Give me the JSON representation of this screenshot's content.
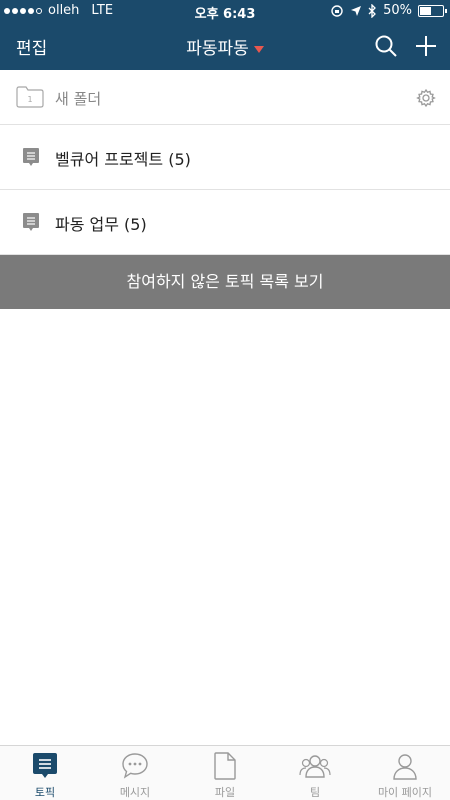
{
  "status_bar": {
    "carrier": "olleh",
    "network": "LTE",
    "time": "오후 6:43",
    "battery": "50%",
    "battery_level": 0.5
  },
  "navbar": {
    "edit_label": "편집",
    "title": "파동파동",
    "search_icon": "search-icon",
    "add_icon": "plus-icon",
    "caret_color": "#e8584f",
    "background_color": "#1b4a6b"
  },
  "folder": {
    "badge": "1",
    "label": "새 폴더",
    "settings_icon": "gear-icon"
  },
  "topics": [
    {
      "label": "벨큐어 프로젝트 (5)"
    },
    {
      "label": "파동 업무 (5)"
    }
  ],
  "show_unjoined_button": "참여하지 않은 토픽 목록 보기",
  "tabbar": {
    "items": [
      {
        "label": "토픽",
        "icon": "topic-icon",
        "active": true
      },
      {
        "label": "메시지",
        "icon": "message-icon",
        "active": false
      },
      {
        "label": "파일",
        "icon": "file-icon",
        "active": false
      },
      {
        "label": "팀",
        "icon": "team-icon",
        "active": false
      },
      {
        "label": "마이 페이지",
        "icon": "profile-icon",
        "active": false
      }
    ]
  }
}
